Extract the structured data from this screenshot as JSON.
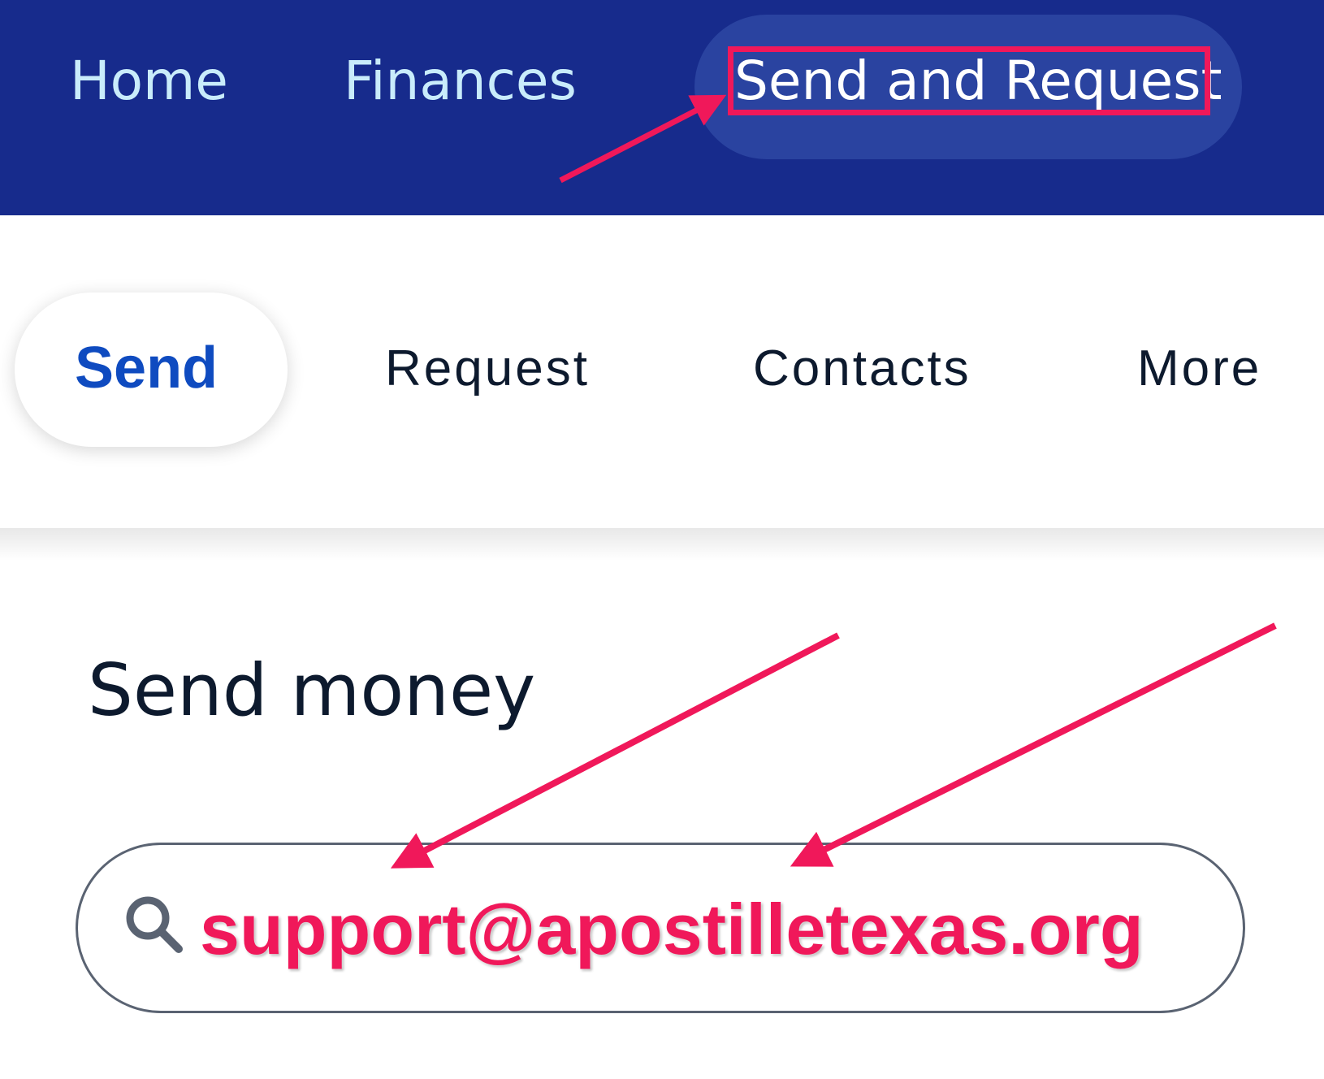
{
  "top_nav": {
    "items": [
      {
        "label": "Home"
      },
      {
        "label": "Finances"
      },
      {
        "label": "Send and Request"
      }
    ],
    "active_index": 2
  },
  "sub_nav": {
    "items": [
      {
        "label": "Send"
      },
      {
        "label": "Request"
      },
      {
        "label": "Contacts"
      },
      {
        "label": "More"
      }
    ],
    "active_index": 0
  },
  "main": {
    "title": "Send money",
    "search": {
      "value": "support@apostilletexas.org"
    }
  },
  "colors": {
    "topbar_bg": "#172b8c",
    "annotation": "#f0185a",
    "active_subnav": "#0f4bc0"
  }
}
